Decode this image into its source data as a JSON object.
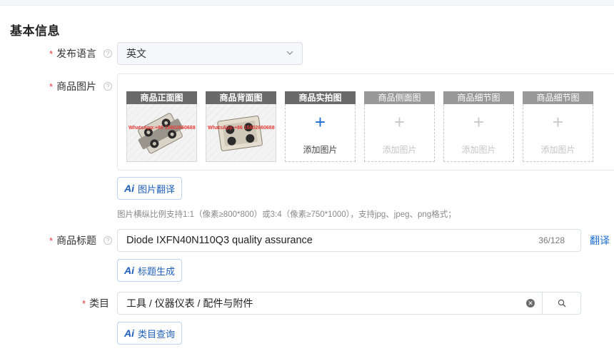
{
  "section_title": "基本信息",
  "language": {
    "label": "发布语言",
    "value": "英文"
  },
  "images": {
    "label": "商品图片",
    "slots": [
      {
        "head": "商品正面图",
        "watermark": "WhatsApp:+86 15602660688"
      },
      {
        "head": "商品背面图",
        "watermark": "WhatsApp:+86 15602660688"
      },
      {
        "head": "商品实拍图",
        "add": "添加图片"
      },
      {
        "head": "商品侧面图",
        "add": "添加图片"
      },
      {
        "head": "商品细节图",
        "add": "添加图片"
      },
      {
        "head": "商品细节图",
        "add": "添加图片"
      }
    ],
    "translate_button": "图片翻译",
    "hint": "图片横纵比例支持1:1（像素≥800*800）或3:4（像素≥750*1000），支持jpg、jpeg、png格式；"
  },
  "title": {
    "label": "商品标题",
    "value": "Diode IXFN40N110Q3 quality assurance",
    "count": "36/128",
    "translate_link": "翻译",
    "generate_button": "标题生成"
  },
  "category": {
    "label": "类目",
    "value": "工具 / 仪器仪表 / 配件与附件",
    "query_button": "类目查询"
  },
  "ai_mark": "Ai",
  "required_mark": "*",
  "help_mark": "?",
  "colors": {
    "accent": "#1f6fd1",
    "required": "#e53935"
  }
}
